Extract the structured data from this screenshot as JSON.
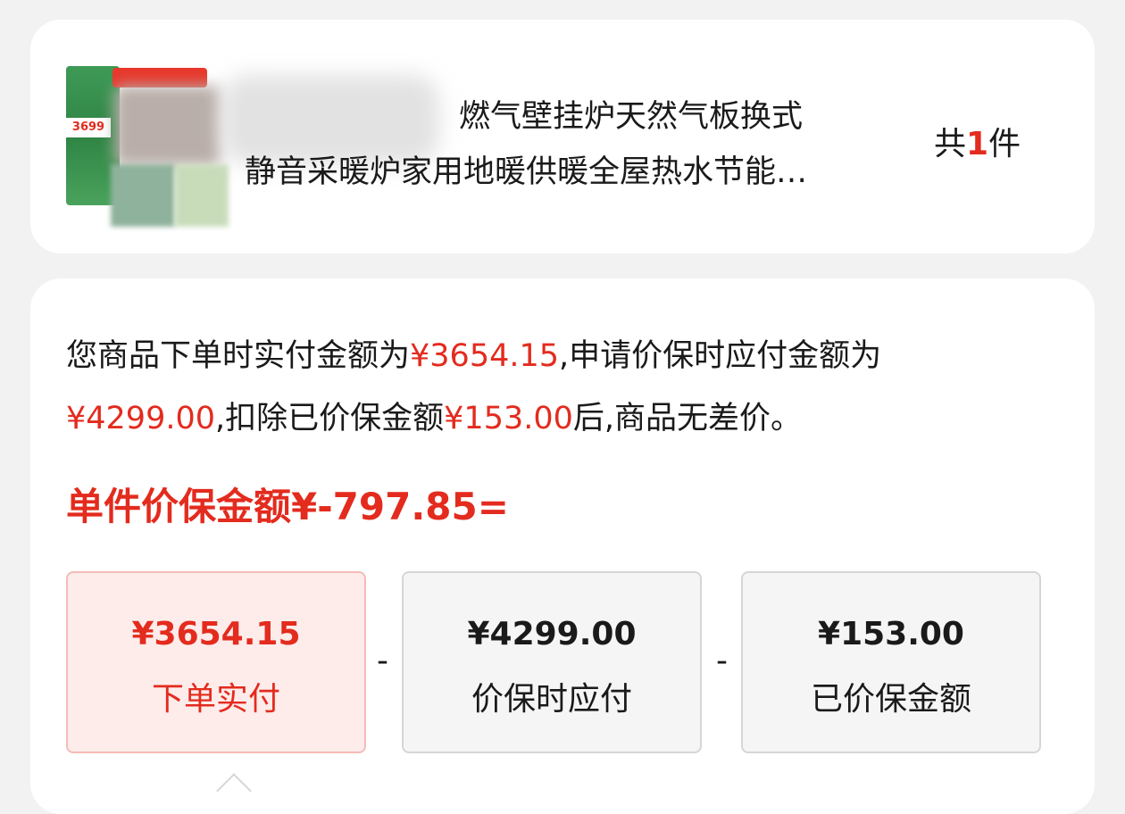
{
  "product": {
    "thumbnail_price": "3699",
    "title_line1": "燃气壁挂炉天然气板换式",
    "title_line2": "静音采暖炉家用地暖供暖全屋热水节能…",
    "quantity_prefix": "共",
    "quantity_value": "1",
    "quantity_suffix": "件"
  },
  "description": {
    "part1": "您商品下单时实付金额为",
    "paid_amount": "¥3654.15",
    "part2": ",申请价保时应付金额为",
    "payable_amount": "¥4299.00",
    "part3": ",扣除已价保金额",
    "protected_amount": "¥153.00",
    "part4": "后,商品无差价。"
  },
  "formula": {
    "label": "单件价保金额",
    "value": "¥-797.85",
    "equals": "="
  },
  "boxes": [
    {
      "amount": "¥3654.15",
      "label": "下单实付"
    },
    {
      "amount": "¥4299.00",
      "label": "价保时应付"
    },
    {
      "amount": "¥153.00",
      "label": "已价保金额"
    }
  ],
  "operators": [
    "-",
    "-"
  ],
  "colors": {
    "accent": "#e32b1e",
    "highlight_bg": "#fdecea",
    "page_bg": "#f2f2f2",
    "card_bg": "#ffffff"
  }
}
